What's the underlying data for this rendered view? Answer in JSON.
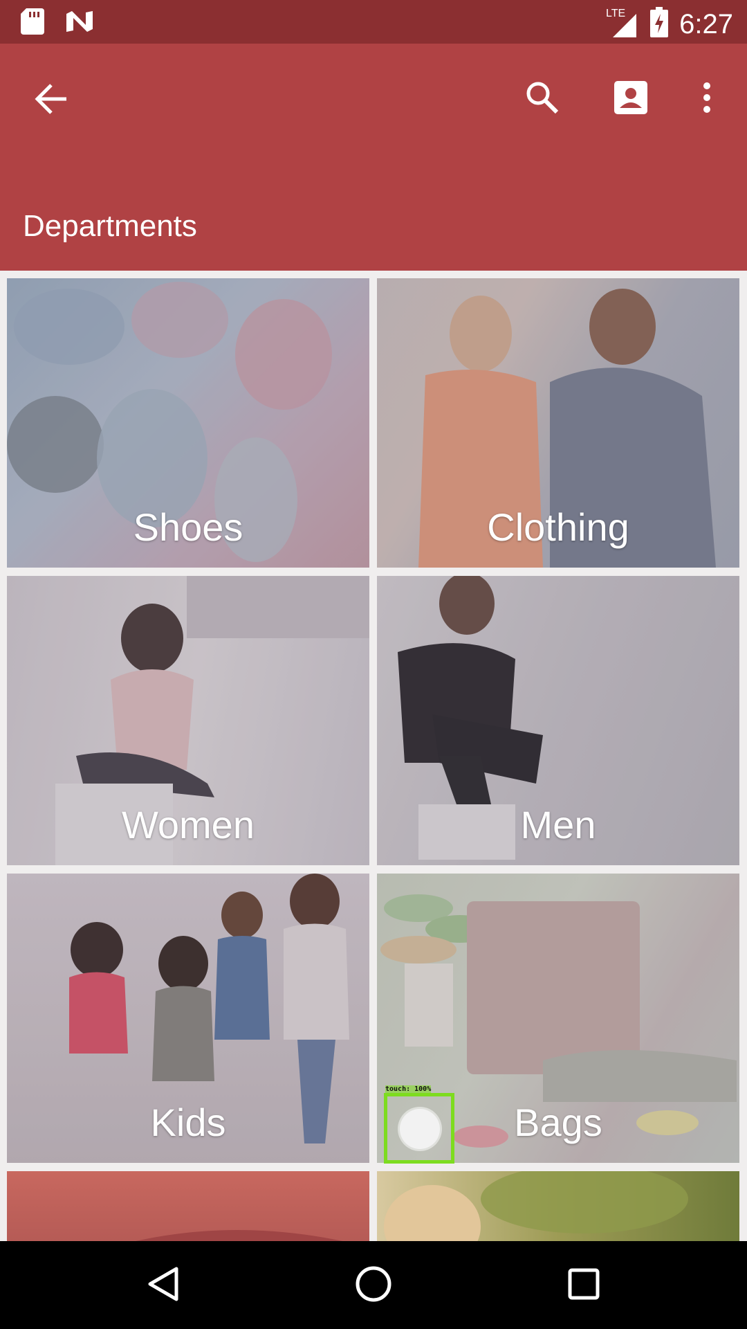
{
  "status_bar": {
    "time": "6:27",
    "network": "LTE",
    "icons": [
      "sd-card-icon",
      "n-notification-icon",
      "lte-signal-icon",
      "battery-charging-icon"
    ]
  },
  "app_bar": {
    "title": "Departments",
    "actions": [
      "back-arrow-icon",
      "search-icon",
      "account-icon",
      "more-vert-icon"
    ],
    "color": "#b04244"
  },
  "departments": [
    {
      "label": "Shoes"
    },
    {
      "label": "Clothing"
    },
    {
      "label": "Women"
    },
    {
      "label": "Men"
    },
    {
      "label": "Kids"
    },
    {
      "label": "Bags"
    }
  ],
  "touch_overlay": {
    "label": "touch: 100%"
  },
  "nav_bar": {
    "buttons": [
      "back-triangle-icon",
      "home-circle-icon",
      "recents-square-icon"
    ]
  }
}
